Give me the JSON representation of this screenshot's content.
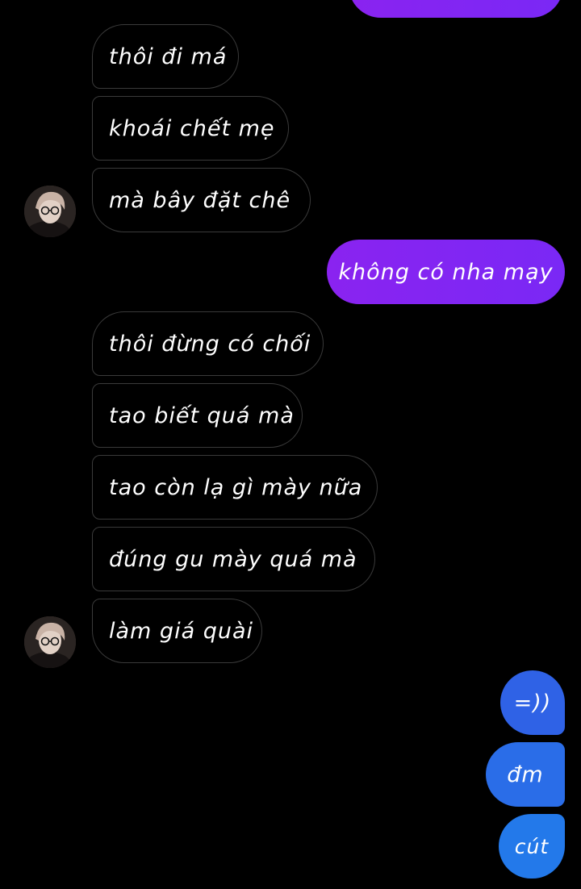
{
  "messages": {
    "received": [
      "thôi đi má",
      "khoái chết mẹ",
      "mà bây đặt chê",
      "thôi đừng có chối",
      "tao biết quá mà",
      "tao còn lạ gì mày nữa",
      "đúng gu mày quá mà",
      "làm giá quài"
    ],
    "sent": [
      "không có nha mạy",
      "=))",
      "đm",
      "cút"
    ]
  },
  "colors": {
    "sent_purple": "#8a23f0",
    "sent_blue": "#2a6de8",
    "received_border": "#3a3a3a"
  }
}
